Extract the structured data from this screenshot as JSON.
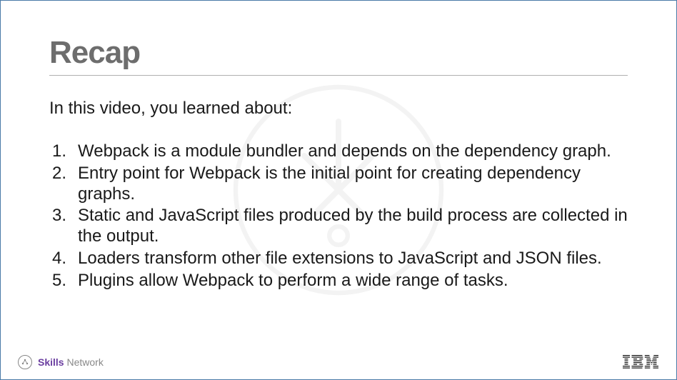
{
  "title": "Recap",
  "intro": "In this video, you learned about:",
  "items": [
    "Webpack is a module bundler and depends on the dependency graph.",
    "Entry point for Webpack is the initial point for creating dependency graphs.",
    "Static and JavaScript files produced by the build process are collected in the output.",
    "Loaders transform other file extensions to JavaScript and JSON files.",
    "Plugins allow Webpack to perform a wide range of tasks."
  ],
  "footer": {
    "brand_bold": "Skills",
    "brand_light": " Network",
    "right_logo": "IBM"
  }
}
